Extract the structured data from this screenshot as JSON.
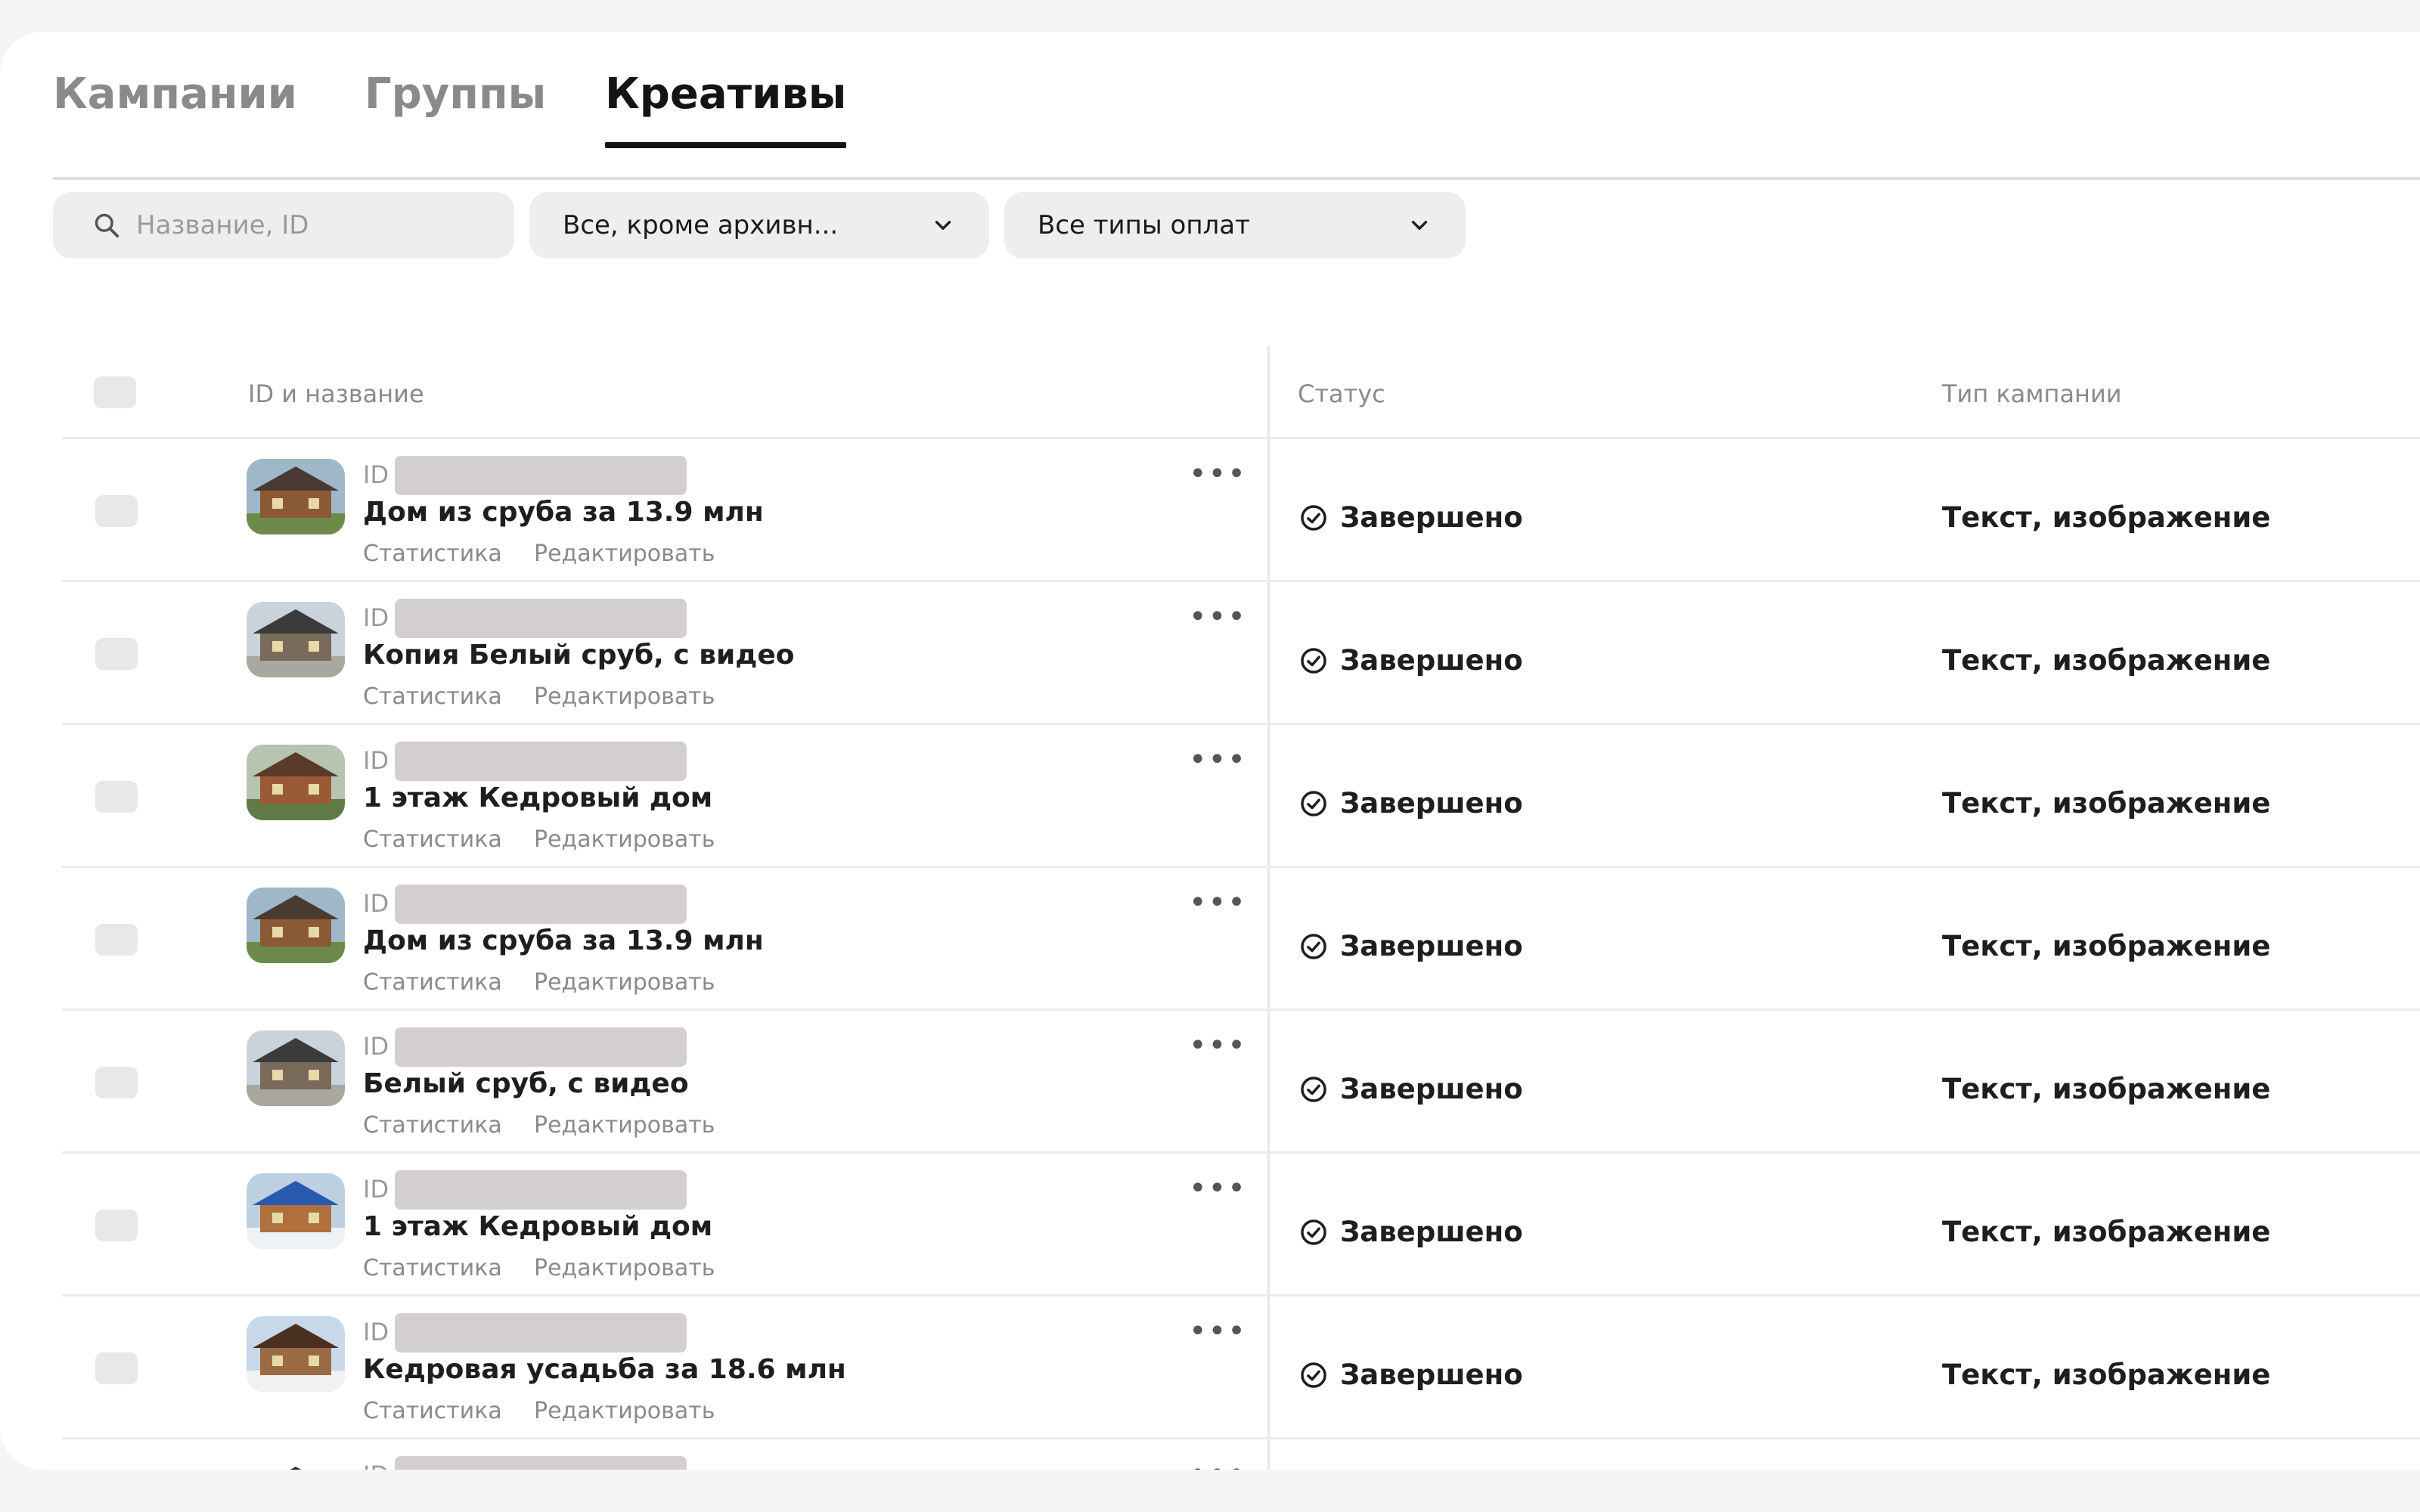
{
  "tabs": [
    {
      "label": "Кампании",
      "active": false
    },
    {
      "label": "Группы",
      "active": false
    },
    {
      "label": "Креативы",
      "active": true
    }
  ],
  "filters": {
    "search_placeholder": "Название, ID",
    "status_select": "Все, кроме архивн...",
    "payment_select": "Все типы оплат"
  },
  "table": {
    "headers": {
      "id_name": "ID и название",
      "status": "Статус",
      "campaign_type": "Тип кампании"
    },
    "rows": [
      {
        "id_label": "ID",
        "title": "Дом из сруба за 13.9 млн",
        "stats_link": "Статистика",
        "edit_link": "Редактировать",
        "status": "Завершено",
        "type": "Текст, изображение",
        "thumb": "house-log-facade"
      },
      {
        "id_label": "ID",
        "title": "Копия Белый сруб, с видео",
        "stats_link": "Статистика",
        "edit_link": "Редактировать",
        "status": "Завершено",
        "type": "Текст, изображение",
        "thumb": "house-with-people"
      },
      {
        "id_label": "ID",
        "title": "1 этаж Кедровый дом",
        "stats_link": "Статистика",
        "edit_link": "Редактировать",
        "status": "Завершено",
        "type": "Текст, изображение",
        "thumb": "cedar-house"
      },
      {
        "id_label": "ID",
        "title": "Дом из сруба за 13.9 млн",
        "stats_link": "Статистика",
        "edit_link": "Редактировать",
        "status": "Завершено",
        "type": "Текст, изображение",
        "thumb": "house-log-facade"
      },
      {
        "id_label": "ID",
        "title": "Белый сруб, с видео",
        "stats_link": "Статистика",
        "edit_link": "Редактировать",
        "status": "Завершено",
        "type": "Текст, изображение",
        "thumb": "house-with-people"
      },
      {
        "id_label": "ID",
        "title": "1 этаж Кедровый дом",
        "stats_link": "Статистика",
        "edit_link": "Редактировать",
        "status": "Завершено",
        "type": "Текст, изображение",
        "thumb": "cedar-house-winter"
      },
      {
        "id_label": "ID",
        "title": "Кедровая усадьба за 18.6 млн",
        "stats_link": "Статистика",
        "edit_link": "Редактировать",
        "status": "Завершено",
        "type": "Текст, изображение",
        "thumb": "estate-winter"
      },
      {
        "id_label": "ID",
        "title": "",
        "stats_link": "",
        "edit_link": "",
        "status": "",
        "type": "",
        "thumb": "house-roof"
      }
    ]
  }
}
